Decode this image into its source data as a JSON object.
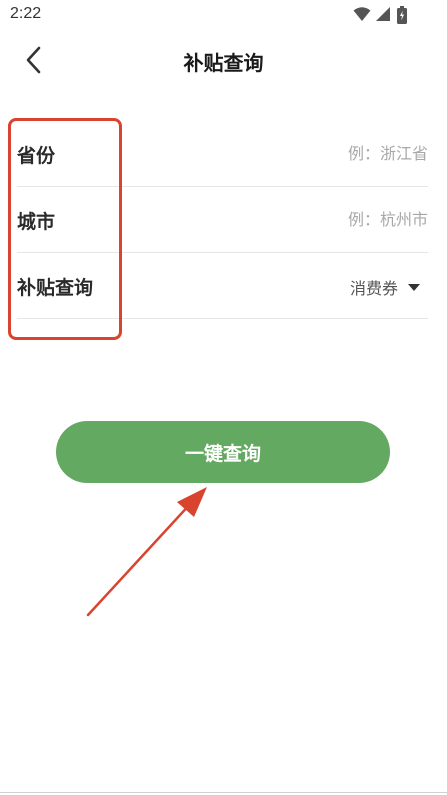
{
  "status_bar": {
    "time": "2:22",
    "icons": [
      "wifi-icon",
      "signal-icon",
      "battery-icon"
    ]
  },
  "nav": {
    "title": "补贴查询",
    "back_icon": "chevron-left-icon"
  },
  "form": {
    "province": {
      "label": "省份",
      "value": "",
      "placeholder": "例：浙江省"
    },
    "city": {
      "label": "城市",
      "value": "",
      "placeholder": "例：杭州市"
    },
    "subsidy_type": {
      "label": "补贴查询",
      "selected": "消费券"
    }
  },
  "actions": {
    "query_label": "一键查询"
  },
  "colors": {
    "primary_green": "#64a961",
    "annotation_red": "#d9442e"
  }
}
